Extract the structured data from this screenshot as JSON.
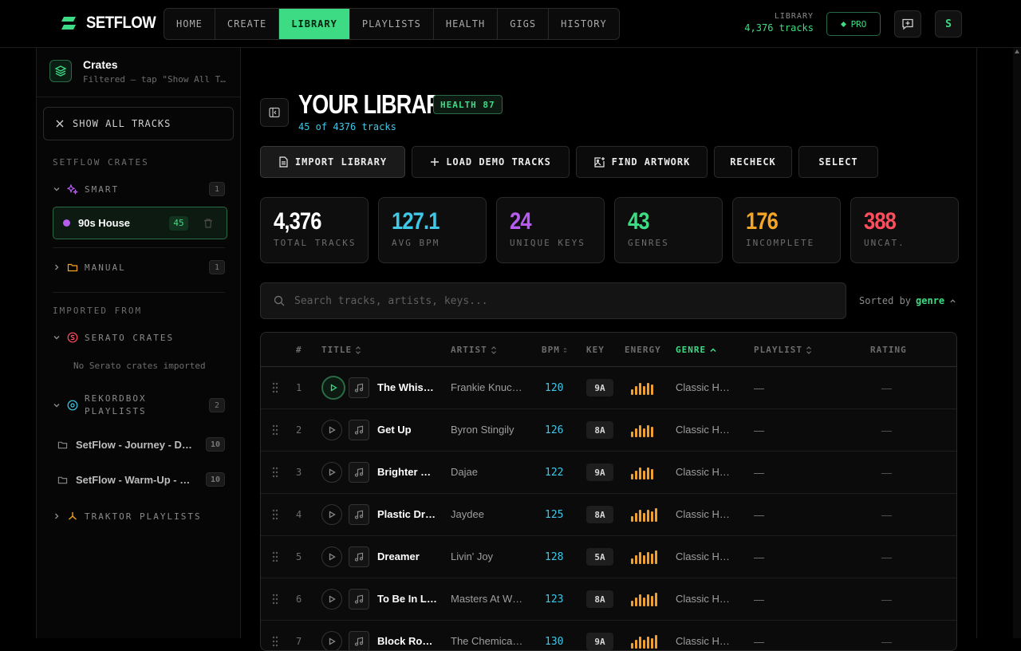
{
  "app": {
    "name": "SETFLOW"
  },
  "nav": [
    {
      "label": "HOME",
      "active": false
    },
    {
      "label": "CREATE",
      "active": false
    },
    {
      "label": "LIBRARY",
      "active": true
    },
    {
      "label": "PLAYLISTS",
      "active": false
    },
    {
      "label": "HEALTH",
      "active": false
    },
    {
      "label": "GIGS",
      "active": false
    },
    {
      "label": "HISTORY",
      "active": false
    }
  ],
  "header": {
    "library_label": "LIBRARY",
    "library_count": "4,376 tracks",
    "pro_label": "PRO",
    "avatar_initial": "S"
  },
  "sidebar": {
    "title": "Crates",
    "subtitle": "Filtered — tap \"Show All Tracks\"",
    "show_all": "SHOW ALL TRACKS",
    "setflow_crates_label": "SETFLOW CRATES",
    "smart_label": "SMART",
    "smart_count": "1",
    "active_crate": {
      "name": "90s House",
      "count": "45"
    },
    "manual_label": "MANUAL",
    "manual_count": "1",
    "imported_label": "IMPORTED FROM",
    "serato_label": "SERATO CRATES",
    "serato_empty": "No Serato crates imported",
    "rekordbox_label": "REKORDBOX PLAYLISTS",
    "rekordbox_count": "2",
    "rekordbox_playlists": [
      {
        "name": "SetFlow - Journey - Deep House",
        "count": "10"
      },
      {
        "name": "SetFlow - Warm-Up - Deep House",
        "count": "10"
      }
    ],
    "traktor_label": "TRAKTOR PLAYLISTS"
  },
  "main": {
    "title": "YOUR LIBRARY",
    "health_badge": "HEALTH 87",
    "subcount": "45 of 4376 tracks",
    "actions": {
      "import": "IMPORT LIBRARY",
      "demo": "LOAD DEMO TRACKS",
      "artwork": "FIND ARTWORK",
      "recheck": "RECHECK",
      "select": "SELECT"
    },
    "stats": [
      {
        "value": "4,376",
        "label": "TOTAL TRACKS",
        "color": "#ffffff"
      },
      {
        "value": "127.1",
        "label": "AVG BPM",
        "color": "#3ec9e8"
      },
      {
        "value": "24",
        "label": "UNIQUE KEYS",
        "color": "#b65df0"
      },
      {
        "value": "43",
        "label": "GENRES",
        "color": "#3ddc84"
      },
      {
        "value": "176",
        "label": "INCOMPLETE",
        "color": "#f5a524"
      },
      {
        "value": "388",
        "label": "UNCAT.",
        "color": "#ff4d5e"
      }
    ],
    "search_placeholder": "Search tracks, artists, keys...",
    "sorted_prefix": "Sorted by",
    "sorted_field": "genre",
    "columns": {
      "num": "#",
      "title": "TITLE",
      "artist": "ARTIST",
      "bpm": "BPM",
      "key": "KEY",
      "energy": "ENERGY",
      "genre": "GENRE",
      "playlist": "PLAYLIST",
      "rating": "RATING"
    },
    "tracks": [
      {
        "num": "1",
        "title": "The Whistle Song",
        "artist": "Frankie Knuckles",
        "bpm": "120",
        "key": "9A",
        "energy": 6,
        "genre": "Classic House",
        "playlist": "—",
        "rating": "—"
      },
      {
        "num": "2",
        "title": "Get Up",
        "artist": "Byron Stingily",
        "bpm": "126",
        "key": "8A",
        "energy": 6,
        "genre": "Classic House",
        "playlist": "—",
        "rating": "—"
      },
      {
        "num": "3",
        "title": "Brighter Days",
        "artist": "Dajae",
        "bpm": "122",
        "key": "9A",
        "energy": 6,
        "genre": "Classic House",
        "playlist": "—",
        "rating": "—"
      },
      {
        "num": "4",
        "title": "Plastic Dreams",
        "artist": "Jaydee",
        "bpm": "125",
        "key": "8A",
        "energy": 7,
        "genre": "Classic House",
        "playlist": "—",
        "rating": "—"
      },
      {
        "num": "5",
        "title": "Dreamer",
        "artist": "Livin' Joy",
        "bpm": "128",
        "key": "5A",
        "energy": 7,
        "genre": "Classic House",
        "playlist": "—",
        "rating": "—"
      },
      {
        "num": "6",
        "title": "To Be In Love",
        "artist": "Masters At Work",
        "bpm": "123",
        "key": "8A",
        "energy": 7,
        "genre": "Classic House",
        "playlist": "—",
        "rating": "—"
      },
      {
        "num": "7",
        "title": "Block Rockin' Beats",
        "artist": "The Chemical Brothers",
        "bpm": "130",
        "key": "9A",
        "energy": 7,
        "genre": "Classic House",
        "playlist": "—",
        "rating": "—"
      }
    ]
  }
}
